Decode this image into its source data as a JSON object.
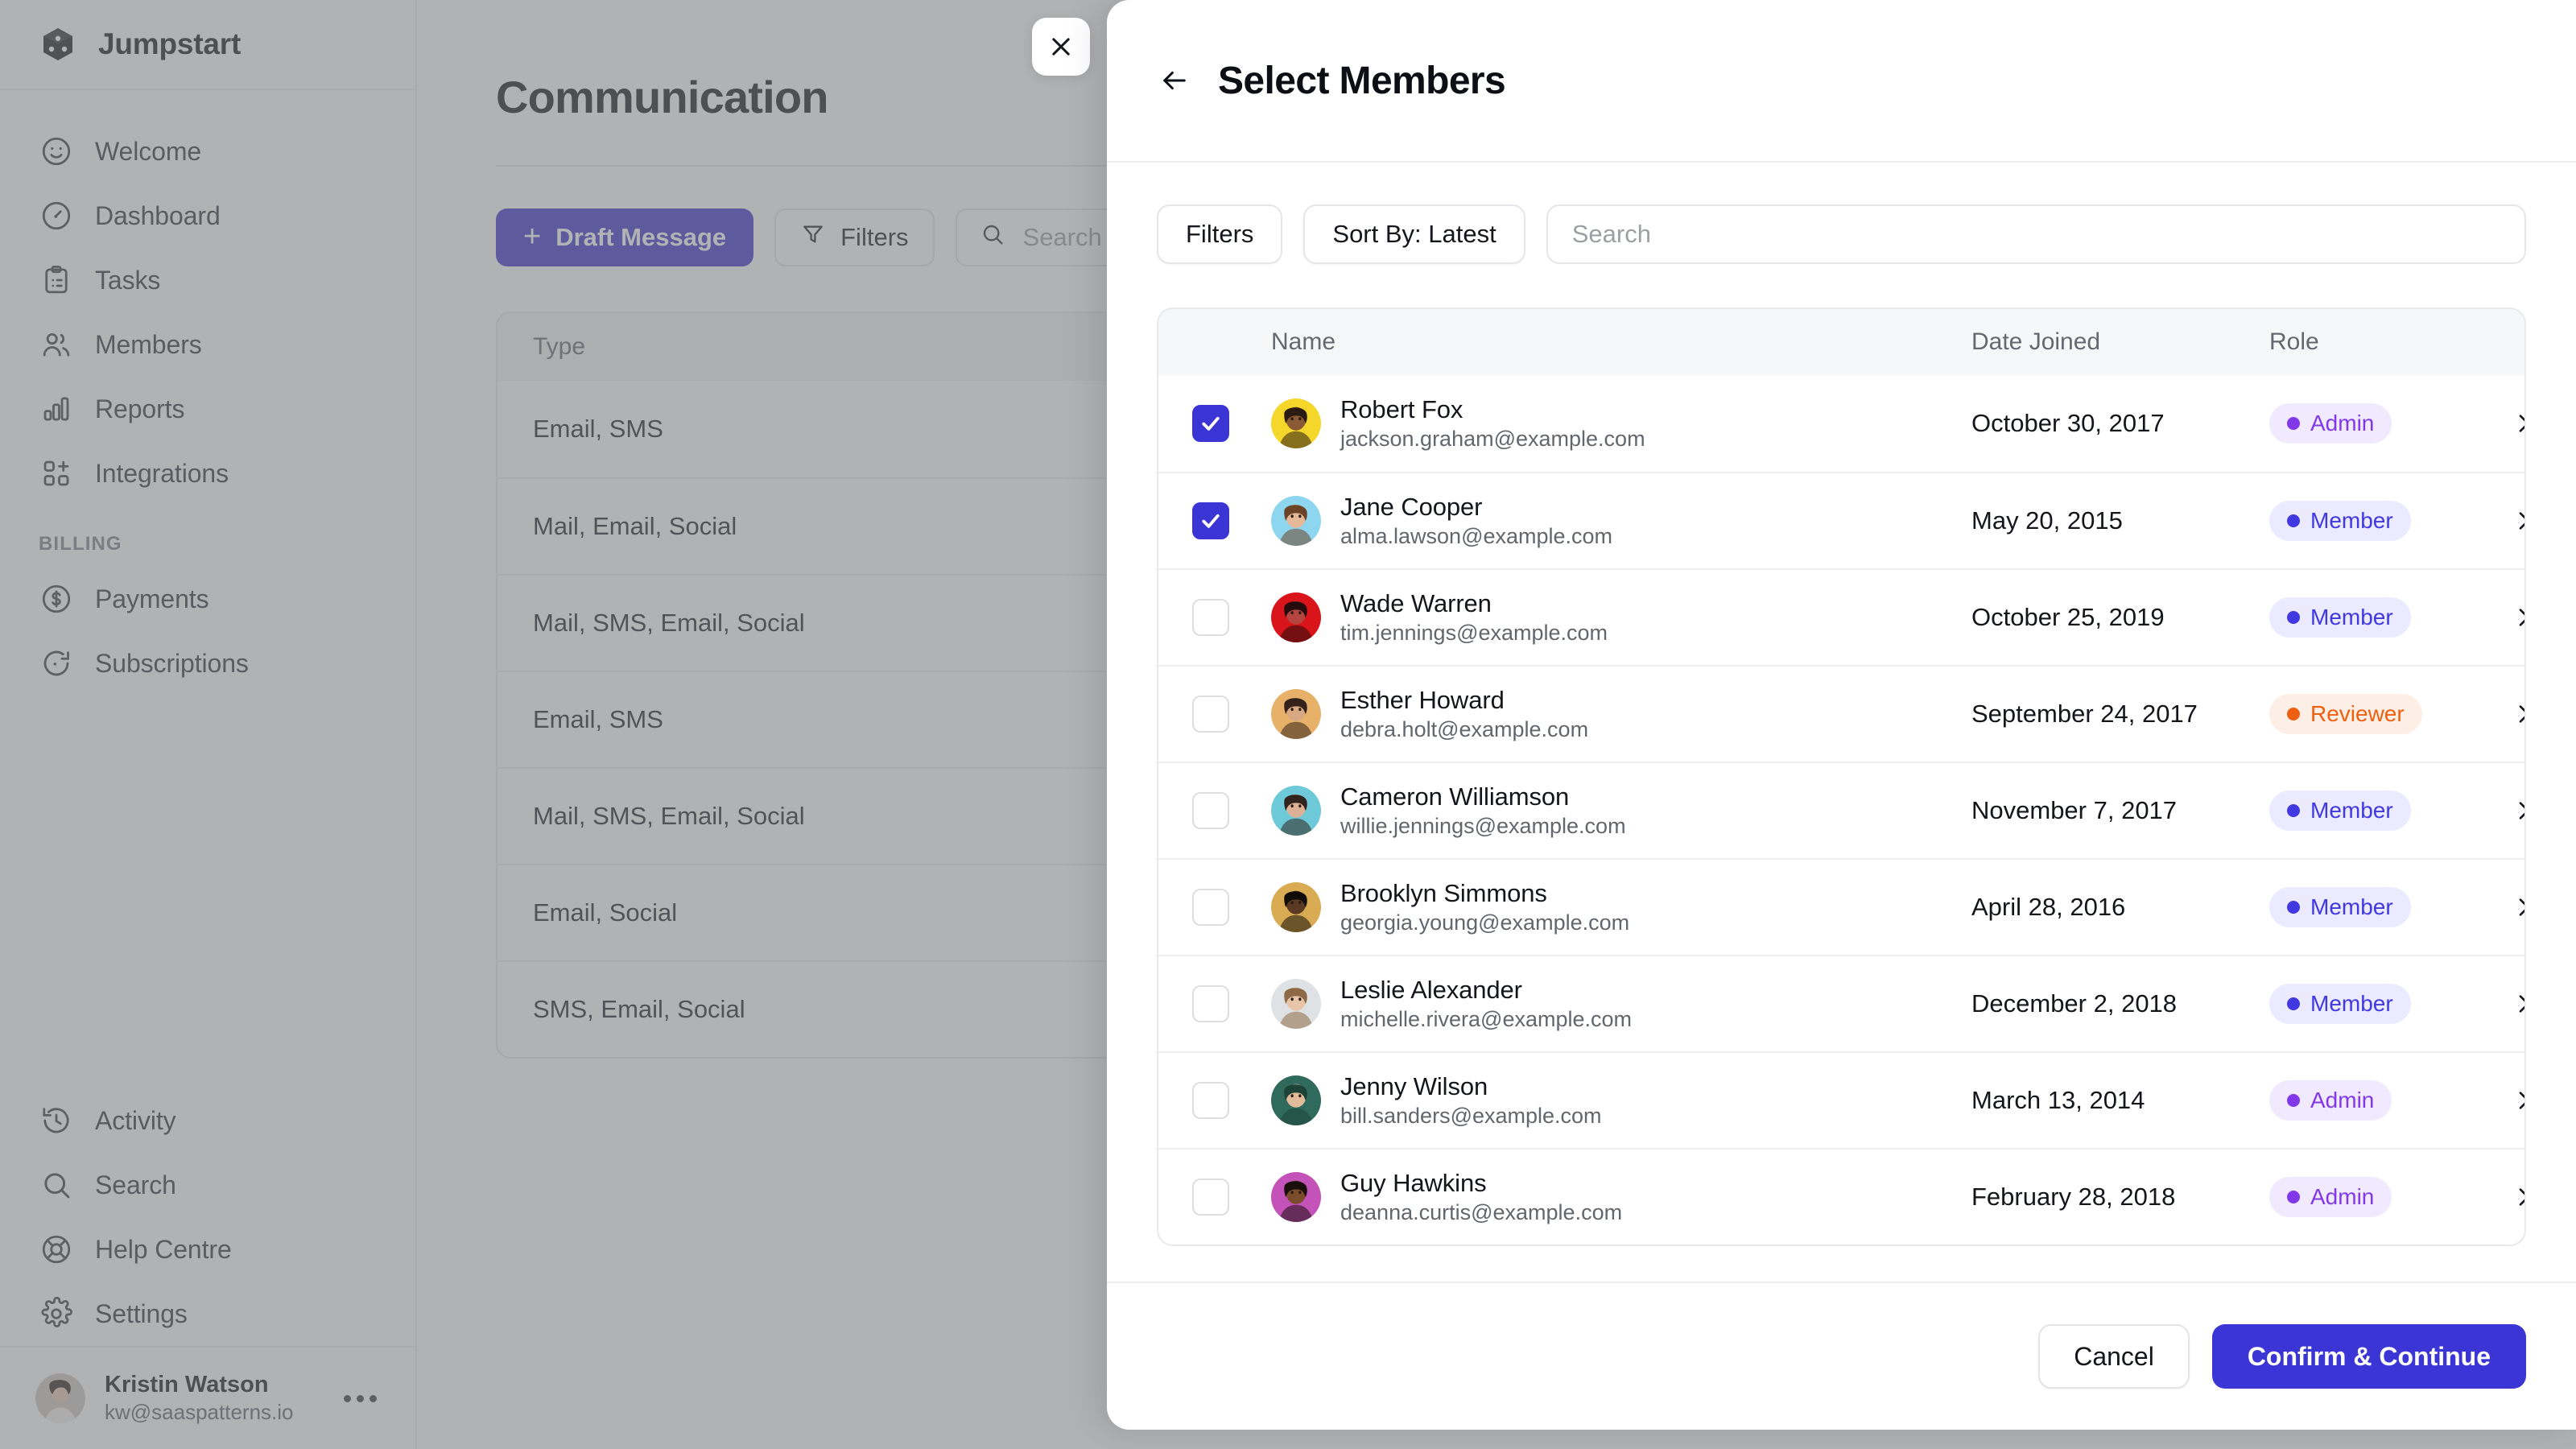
{
  "app": {
    "brand": {
      "name": "Jumpstart",
      "icon": "cube-icon"
    },
    "sidebar": {
      "primary_items": [
        {
          "label": "Welcome",
          "icon": "smiley-icon"
        },
        {
          "label": "Dashboard",
          "icon": "gauge-icon"
        },
        {
          "label": "Tasks",
          "icon": "clipboard-icon"
        },
        {
          "label": "Members",
          "icon": "users-icon"
        },
        {
          "label": "Reports",
          "icon": "bar-chart-icon"
        },
        {
          "label": "Integrations",
          "icon": "grid-plus-icon"
        }
      ],
      "section_label": "BILLING",
      "billing_items": [
        {
          "label": "Payments",
          "icon": "dollar-circle-icon"
        },
        {
          "label": "Subscriptions",
          "icon": "refresh-icon"
        }
      ],
      "bottom_items": [
        {
          "label": "Activity",
          "icon": "history-icon"
        },
        {
          "label": "Search",
          "icon": "search-icon"
        },
        {
          "label": "Help Centre",
          "icon": "lifebuoy-icon"
        },
        {
          "label": "Settings",
          "icon": "gear-icon"
        }
      ],
      "user": {
        "name": "Kristin Watson",
        "email": "kw@saaspatterns.io",
        "menu_icon": "ellipsis-icon"
      }
    },
    "page": {
      "title": "Communication",
      "toolbar": {
        "draft_label": "Draft Message",
        "draft_icon": "plus-icon",
        "filters_label": "Filters",
        "filters_icon": "funnel-icon",
        "search_placeholder": "Search",
        "search_icon": "search-icon"
      },
      "table": {
        "column_header": "Type",
        "rows": [
          "Email, SMS",
          "Mail, Email, Social",
          "Mail, SMS, Email, Social",
          "Email, SMS",
          "Mail, SMS, Email, Social",
          "Email, Social",
          "SMS, Email, Social"
        ]
      }
    }
  },
  "modal": {
    "close_icon": "close-icon",
    "back_icon": "arrow-left-icon",
    "title": "Select Members",
    "filters_label": "Filters",
    "sort_label": "Sort By: Latest",
    "search_placeholder": "Search",
    "columns": {
      "select": "",
      "name": "Name",
      "date": "Date Joined",
      "role": "Role"
    },
    "members": [
      {
        "name": "Robert Fox",
        "email": "jackson.graham@example.com",
        "date": "October 30, 2017",
        "role": "Admin",
        "role_kind": "admin",
        "checked": true,
        "avatar_bg": "#f5d72b",
        "skin": "#8a5a34",
        "hair": "#2a1c12"
      },
      {
        "name": "Jane Cooper",
        "email": "alma.lawson@example.com",
        "date": "May 20, 2015",
        "role": "Member",
        "role_kind": "member",
        "checked": true,
        "avatar_bg": "#8ed6ef",
        "skin": "#e5b897",
        "hair": "#6b4427"
      },
      {
        "name": "Wade Warren",
        "email": "tim.jennings@example.com",
        "date": "October 25, 2019",
        "role": "Member",
        "role_kind": "member",
        "checked": false,
        "avatar_bg": "#d9141a",
        "skin": "#b4453f",
        "hair": "#250b0b"
      },
      {
        "name": "Esther Howard",
        "email": "debra.holt@example.com",
        "date": "September 24, 2017",
        "role": "Reviewer",
        "role_kind": "reviewer",
        "checked": false,
        "avatar_bg": "#e7b16a",
        "skin": "#d8a882",
        "hair": "#34211a"
      },
      {
        "name": "Cameron Williamson",
        "email": "willie.jennings@example.com",
        "date": "November 7, 2017",
        "role": "Member",
        "role_kind": "member",
        "checked": false,
        "avatar_bg": "#6ec9d8",
        "skin": "#dcb196",
        "hair": "#30241d"
      },
      {
        "name": "Brooklyn Simmons",
        "email": "georgia.young@example.com",
        "date": "April 28, 2016",
        "role": "Member",
        "role_kind": "member",
        "checked": false,
        "avatar_bg": "#d9ab52",
        "skin": "#5a3a22",
        "hair": "#110c09"
      },
      {
        "name": "Leslie Alexander",
        "email": "michelle.rivera@example.com",
        "date": "December 2, 2018",
        "role": "Member",
        "role_kind": "member",
        "checked": false,
        "avatar_bg": "#dfe2e4",
        "skin": "#e8c5a8",
        "hair": "#8d6a45"
      },
      {
        "name": "Jenny Wilson",
        "email": "bill.sanders@example.com",
        "date": "March 13, 2014",
        "role": "Admin",
        "role_kind": "admin",
        "checked": false,
        "avatar_bg": "#2f6a5c",
        "skin": "#e2bb9b",
        "hair": "#1d4238"
      },
      {
        "name": "Guy Hawkins",
        "email": "deanna.curtis@example.com",
        "date": "February 28, 2018",
        "role": "Admin",
        "role_kind": "admin",
        "checked": false,
        "avatar_bg": "#c353b9",
        "skin": "#7a4c2c",
        "hair": "#190f0d"
      }
    ],
    "footer": {
      "cancel_label": "Cancel",
      "confirm_label": "Confirm & Continue"
    }
  },
  "colors": {
    "brand_indigo": "#3b35d6",
    "member_badge": "#4038e0",
    "admin_badge": "#8038e8",
    "reviewer_badge": "#ef5f10"
  }
}
